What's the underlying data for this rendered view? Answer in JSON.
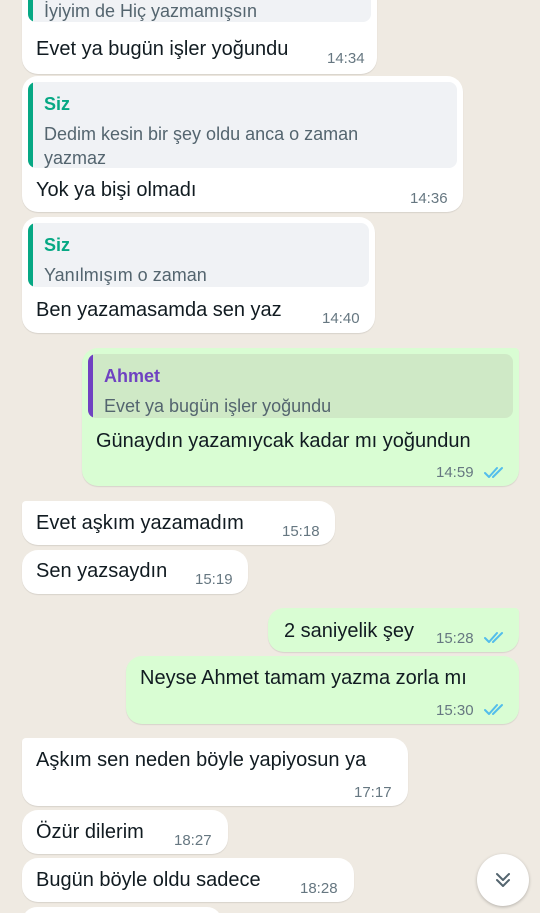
{
  "colors": {
    "background": "#efeae2",
    "incoming_bubble": "#ffffff",
    "outgoing_bubble": "#d9fdd3",
    "quote_you": "#06a884",
    "quote_other": "#6f42c1",
    "read_ticks": "#53bdeb"
  },
  "messages": [
    {
      "quote_fragment": "İyiyim de Hiç yazmamışsın",
      "text": "Evet ya bugün işler yoğundu",
      "time": "14:34"
    },
    {
      "quote_author": "Siz",
      "quote_text": "Dedim kesin bir şey oldu anca o zaman yazmaz",
      "text": "Yok ya bişi olmadı",
      "time": "14:36"
    },
    {
      "quote_author": "Siz",
      "quote_text": "Yanılmışım o zaman",
      "text": "Ben yazamasamda sen yaz",
      "time": "14:40"
    },
    {
      "quote_author": "Ahmet",
      "quote_text": "Evet ya bugün işler yoğundu",
      "text": "Günaydın yazamıycak kadar mı yoğundun",
      "time": "14:59",
      "status": "read"
    },
    {
      "text": "Evet aşkım yazamadım",
      "time": "15:18"
    },
    {
      "text": "Sen yazsaydın",
      "time": "15:19"
    },
    {
      "text": "2 saniyelik şey",
      "time": "15:28",
      "status": "read"
    },
    {
      "text": "Neyse Ahmet tamam yazma zorla mı",
      "time": "15:30",
      "status": "read"
    },
    {
      "text": "Aşkım sen neden böyle yapiyosun ya",
      "time": "17:17"
    },
    {
      "text": "Özür dilerim",
      "time": "18:27"
    },
    {
      "text": "Bugün böyle oldu sadece",
      "time": "18:28"
    }
  ],
  "icons": {
    "read_receipt": "double-check-icon",
    "scroll_down": "double-chevron-down-icon"
  }
}
